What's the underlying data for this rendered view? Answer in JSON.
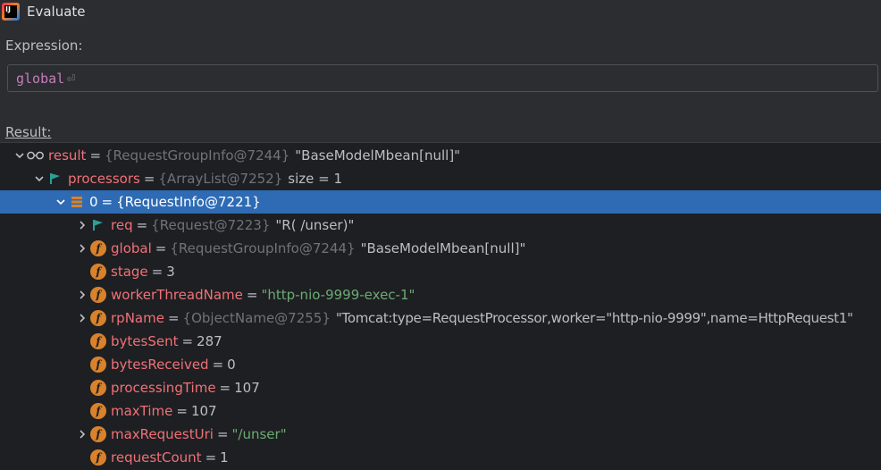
{
  "window": {
    "title": "Evaluate"
  },
  "expression": {
    "label": "Expression:",
    "value": "global"
  },
  "result": {
    "label": "Result:"
  },
  "colors": {
    "selection": "#2e6bb4",
    "field_icon": "#d9822b",
    "flag_icon": "#2aa198",
    "string": "#6aab73",
    "name": "#f07178"
  },
  "rows": [
    {
      "name": "result",
      "eq": "=",
      "type": "{RequestGroupInfo@7244}",
      "value": "\"BaseModelMbean[null]\"",
      "icon": "watch-glasses-icon",
      "expanded": true
    },
    {
      "name": "processors",
      "eq": "=",
      "type": "{ArrayList@7252}",
      "value": "size = 1",
      "icon": "flag-icon",
      "expanded": true
    },
    {
      "name": "0",
      "eq": "=",
      "type": "{RequestInfo@7221}",
      "icon": "array-element-icon",
      "expanded": true,
      "selected": true
    },
    {
      "name": "req",
      "eq": "=",
      "type": "{Request@7223}",
      "value": "\"R( /unser)\"",
      "icon": "flag-icon",
      "expanded": false
    },
    {
      "name": "global",
      "eq": "=",
      "type": "{RequestGroupInfo@7244}",
      "value": "\"BaseModelMbean[null]\"",
      "icon": "field-icon",
      "expanded": false
    },
    {
      "name": "stage",
      "eq": "=",
      "value": "3",
      "icon": "field-icon"
    },
    {
      "name": "workerThreadName",
      "eq": "=",
      "value": "\"http-nio-9999-exec-1\"",
      "icon": "field-icon",
      "expanded": false
    },
    {
      "name": "rpName",
      "eq": "=",
      "type": "{ObjectName@7255}",
      "value": "\"Tomcat:type=RequestProcessor,worker=\"http-nio-9999\",name=HttpRequest1\"",
      "icon": "field-icon",
      "expanded": false
    },
    {
      "name": "bytesSent",
      "eq": "=",
      "value": "287",
      "icon": "field-icon"
    },
    {
      "name": "bytesReceived",
      "eq": "=",
      "value": "0",
      "icon": "field-icon"
    },
    {
      "name": "processingTime",
      "eq": "=",
      "value": "107",
      "icon": "field-icon"
    },
    {
      "name": "maxTime",
      "eq": "=",
      "value": "107",
      "icon": "field-icon"
    },
    {
      "name": "maxRequestUri",
      "eq": "=",
      "value": "\"/unser\"",
      "icon": "field-icon",
      "expanded": false
    },
    {
      "name": "requestCount",
      "eq": "=",
      "value": "1",
      "icon": "field-icon"
    }
  ]
}
